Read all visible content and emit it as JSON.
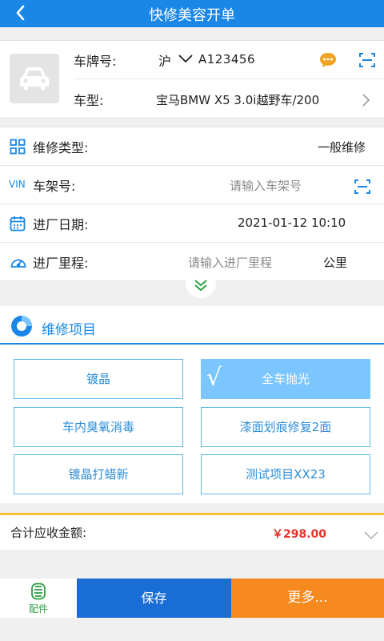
{
  "header": {
    "title": "快修美容开单"
  },
  "vehicle": {
    "plate_label": "车牌号:",
    "plate_province": "沪",
    "plate_number": "A123456",
    "model_label": "车型:",
    "model_value": "宝马BMW X5 3.0i越野车/200"
  },
  "info": {
    "repair_type_label": "维修类型:",
    "repair_type_value": "一般维修",
    "vin_icon_text": "VIN",
    "vin_label": "车架号:",
    "vin_placeholder": "请输入车架号",
    "date_label": "进厂日期:",
    "date_value": "2021-01-12 10:10",
    "mileage_label": "进厂里程:",
    "mileage_placeholder": "请输入进厂里程",
    "mileage_unit": "公里"
  },
  "items": {
    "title": "维修项目",
    "buttons": [
      {
        "label": "镀晶",
        "selected": false
      },
      {
        "label": "全车抛光",
        "selected": true
      },
      {
        "label": "车内臭氧消毒",
        "selected": false
      },
      {
        "label": "漆面划痕修复2面",
        "selected": false
      },
      {
        "label": "镀晶打蜡新",
        "selected": false
      },
      {
        "label": "测试项目XX23",
        "selected": false
      }
    ],
    "check_mark": "√"
  },
  "total": {
    "label": "合计应收金额:",
    "amount": "￥298.00"
  },
  "bottom": {
    "parts_label": "配件",
    "save_label": "保存",
    "more_label": "更多..."
  },
  "colors": {
    "primary": "#1a86e6",
    "selected": "#7bc6ff",
    "amount": "#e2322b",
    "more": "#f68a1e",
    "parts": "#2ea043"
  }
}
